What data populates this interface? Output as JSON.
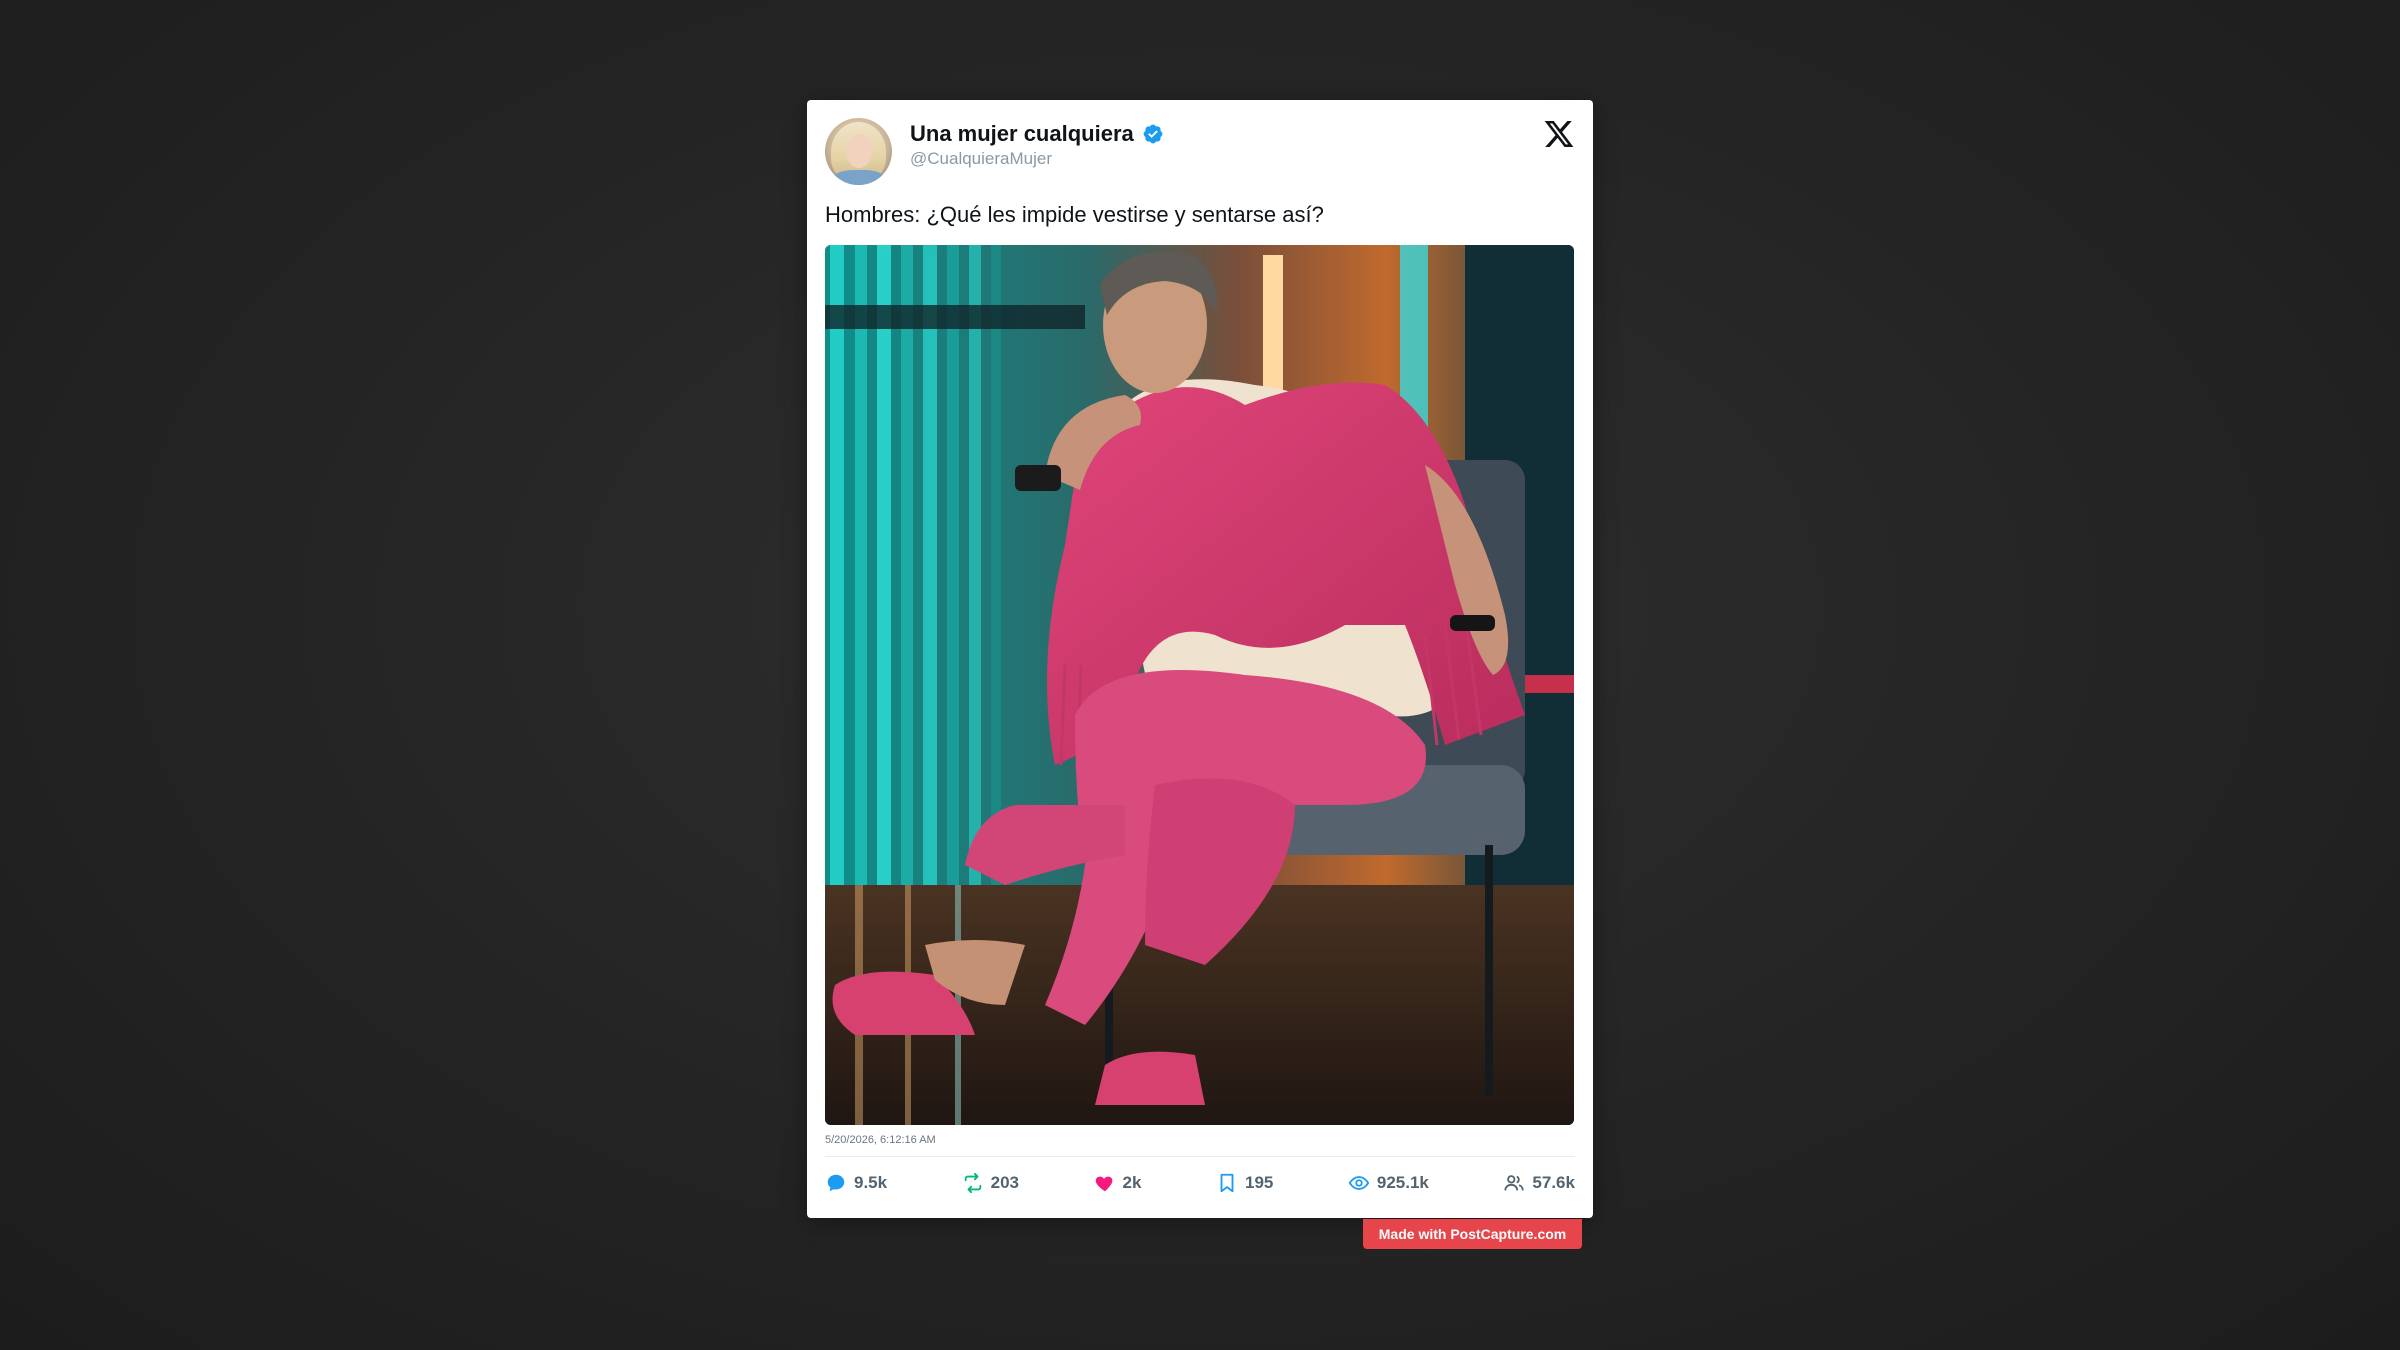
{
  "tweet": {
    "display_name": "Una mujer cualquiera",
    "handle": "@CualquieraMujer",
    "text": "Hombres: ¿Qué les impide vestirse y sentarse así?",
    "timestamp": "5/20/2026, 6:12:16 AM",
    "image_alt": "Man in pink outfit and pink shawl sitting cross-legged on a grey chair on a TV set"
  },
  "icons": {
    "verified": "verified-badge-icon",
    "brand": "x-logo-icon",
    "reply": "reply-icon",
    "retweet": "retweet-icon",
    "like": "heart-icon",
    "bookmark": "bookmark-icon",
    "views": "eye-icon",
    "followers": "people-icon"
  },
  "metrics": {
    "replies": "9.5k",
    "retweets": "203",
    "likes": "2k",
    "bookmarks": "195",
    "views": "925.1k",
    "followers": "57.6k"
  },
  "colors": {
    "reply": "#1d9bf0",
    "retweet": "#00ba7c",
    "like": "#f91880",
    "verified": "#1d9bf0",
    "watermark_bg": "#e5454b"
  },
  "watermark": {
    "label": "Made with PostCapture.com"
  }
}
